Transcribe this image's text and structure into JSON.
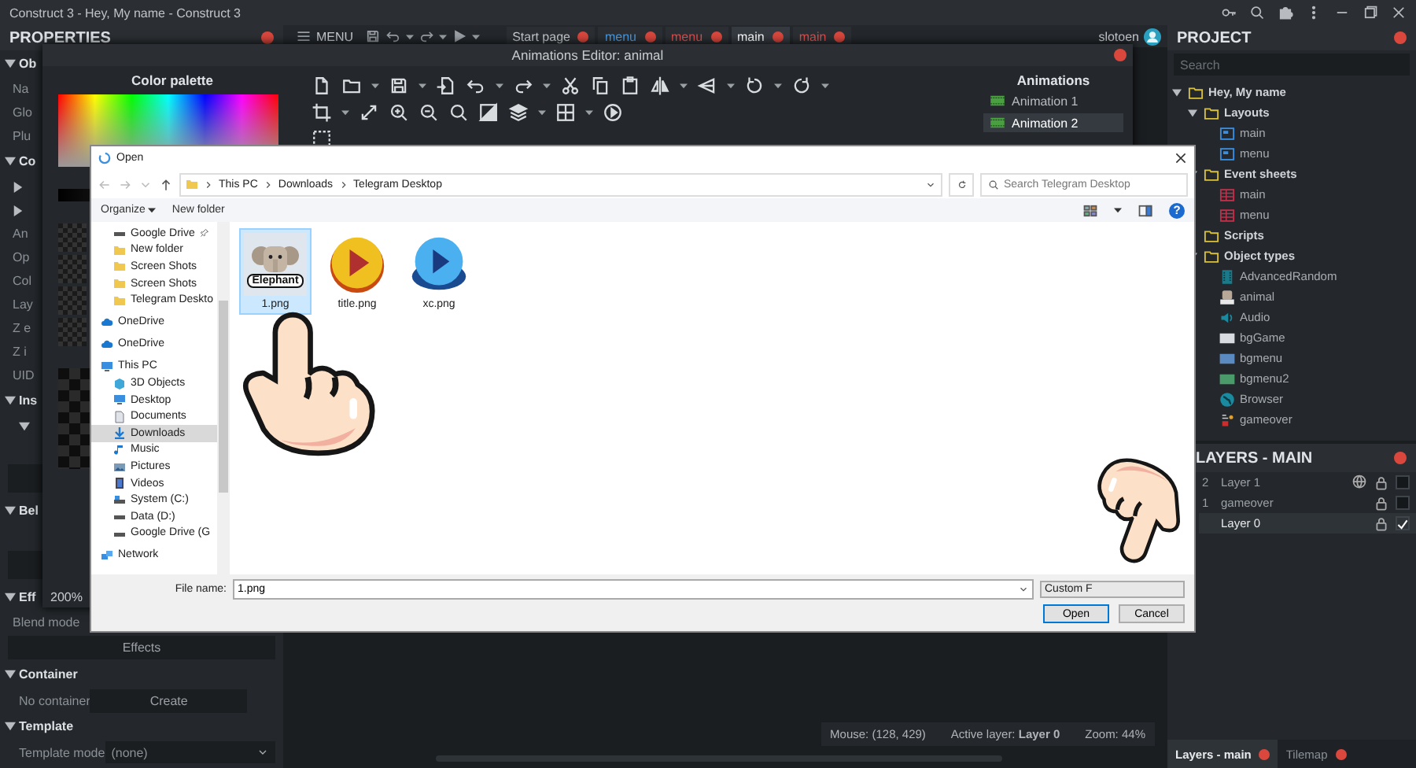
{
  "app_title": "Construct 3 - Hey, My name - Construct 3",
  "properties": {
    "title": "PROPERTIES",
    "rows": [
      {
        "kind": "section",
        "label": "Ob"
      },
      {
        "kind": "field",
        "label": "Na"
      },
      {
        "kind": "field",
        "label": "Glo"
      },
      {
        "kind": "field",
        "label": "Plu"
      },
      {
        "kind": "section",
        "label": "Co"
      },
      {
        "kind": "arrow"
      },
      {
        "kind": "arrow"
      },
      {
        "kind": "field",
        "label": "An"
      },
      {
        "kind": "field",
        "label": "Op"
      },
      {
        "kind": "field",
        "label": "Col"
      },
      {
        "kind": "field",
        "label": "Lay"
      },
      {
        "kind": "field",
        "label": "Z e"
      },
      {
        "kind": "field",
        "label": "Z i"
      },
      {
        "kind": "field",
        "label": "UID"
      },
      {
        "kind": "section",
        "label": "Ins"
      },
      {
        "kind": "expander"
      },
      {
        "kind": "bar"
      },
      {
        "kind": "section",
        "label": "Bel"
      },
      {
        "kind": "bar"
      },
      {
        "kind": "section",
        "label": "Eff"
      },
      {
        "kind": "field",
        "label": "Blend mode"
      },
      {
        "kind": "button",
        "label": "Effects"
      },
      {
        "kind": "section",
        "label": "Container"
      },
      {
        "kind": "pair",
        "label": "No container",
        "button": "Create"
      },
      {
        "kind": "section",
        "label": "Template"
      },
      {
        "kind": "select",
        "label": "Template mode",
        "value": "(none)"
      }
    ]
  },
  "menu_bar": {
    "menu_label": "MENU",
    "user": "slotoen",
    "tabs": [
      {
        "label": "Start page",
        "kind": "page",
        "selected": false
      },
      {
        "label": "menu",
        "kind": "layout",
        "selected": false
      },
      {
        "label": "menu",
        "kind": "eventsheet",
        "selected": false
      },
      {
        "label": "main",
        "kind": "layout",
        "selected": true
      },
      {
        "label": "main",
        "kind": "eventsheet",
        "selected": false
      }
    ]
  },
  "animations_editor": {
    "title": "Animations Editor: animal",
    "palette_title": "Color palette",
    "zoom": "200%",
    "animations_title": "Animations",
    "animations": [
      {
        "name": "Animation 1",
        "selected": false
      },
      {
        "name": "Animation 2",
        "selected": true
      }
    ]
  },
  "project": {
    "title": "PROJECT",
    "search_placeholder": "Search",
    "tree": [
      {
        "name": "Hey, My name",
        "kind": "folder",
        "expanded": true,
        "children": [
          {
            "name": "Layouts",
            "kind": "folder",
            "expanded": true,
            "children": [
              {
                "name": "main",
                "kind": "layout"
              },
              {
                "name": "menu",
                "kind": "layout"
              }
            ]
          },
          {
            "name": "Event sheets",
            "kind": "folder",
            "expanded": true,
            "children": [
              {
                "name": "main",
                "kind": "eventsheet"
              },
              {
                "name": "menu",
                "kind": "eventsheet"
              }
            ]
          },
          {
            "name": "Scripts",
            "kind": "folder"
          },
          {
            "name": "Object types",
            "kind": "folder",
            "expanded": true,
            "children": [
              {
                "name": "AdvancedRandom",
                "kind": "random"
              },
              {
                "name": "animal",
                "kind": "sprite"
              },
              {
                "name": "Audio",
                "kind": "audio"
              },
              {
                "name": "bgGame",
                "kind": "background",
                "color": "#d8dce0"
              },
              {
                "name": "bgmenu",
                "kind": "background",
                "color": "#5a8ac0"
              },
              {
                "name": "bgmenu2",
                "kind": "background",
                "color": "#4a9a6a"
              },
              {
                "name": "Browser",
                "kind": "browser"
              },
              {
                "name": "gameover",
                "kind": "text"
              }
            ]
          }
        ]
      }
    ]
  },
  "layers": {
    "title": "LAYERS - MAIN",
    "rows": [
      {
        "number": "2",
        "name": "Layer 1",
        "global": true,
        "selected": false,
        "visible": false
      },
      {
        "number": "1",
        "name": "gameover",
        "global": false,
        "selected": false,
        "visible": false
      },
      {
        "name": "Layer 0",
        "global": false,
        "selected": true,
        "visible": true
      }
    ],
    "tabs": [
      {
        "label": "Layers - main",
        "selected": true
      },
      {
        "label": "Tilemap",
        "selected": false
      }
    ]
  },
  "status_bar": {
    "mouse": "Mouse: (128, 429)",
    "active_layer": "Active layer: **Layer 0**",
    "zoom": "Zoom: 44%"
  },
  "open_dialog": {
    "title": "Open",
    "breadcrumb": [
      "This PC",
      "Downloads",
      "Telegram Desktop"
    ],
    "search_placeholder": "Search Telegram Desktop",
    "organize": "Organize",
    "new_folder": "New folder",
    "help": "?",
    "quick_access": [
      {
        "name": "Google Drive",
        "kind": "drive",
        "pinned": true,
        "selected": false
      },
      {
        "name": "New folder",
        "kind": "folder",
        "pinned": false,
        "selected": false
      },
      {
        "name": "Screen Shots",
        "kind": "folder",
        "pinned": false,
        "selected": false
      },
      {
        "name": "Screen Shots",
        "kind": "folder",
        "pinned": false,
        "selected": false
      },
      {
        "name": "Telegram Deskto",
        "kind": "folder",
        "pinned": false,
        "selected": false
      }
    ],
    "locations": [
      {
        "name": "OneDrive",
        "kind": "cloud",
        "selected": false
      },
      {
        "name": "OneDrive",
        "kind": "cloud",
        "selected": false
      },
      {
        "name": "This PC",
        "kind": "computer",
        "selected": false,
        "children": [
          {
            "name": "3D Objects",
            "kind": "cube",
            "selected": false
          },
          {
            "name": "Desktop",
            "kind": "desktop",
            "selected": false
          },
          {
            "name": "Documents",
            "kind": "document",
            "selected": false
          },
          {
            "name": "Downloads",
            "kind": "download",
            "selected": true
          },
          {
            "name": "Music",
            "kind": "music",
            "selected": false
          },
          {
            "name": "Pictures",
            "kind": "pictures",
            "selected": false
          },
          {
            "name": "Videos",
            "kind": "videos",
            "selected": false
          },
          {
            "name": "System (C:)",
            "kind": "system",
            "selected": false
          },
          {
            "name": "Data (D:)",
            "kind": "drive",
            "selected": false
          },
          {
            "name": "Google Drive (G",
            "kind": "drive",
            "selected": false
          }
        ]
      },
      {
        "name": "Network",
        "kind": "network",
        "selected": false
      }
    ],
    "files": [
      {
        "name": "1.png",
        "kind": "elephant",
        "thumbnail_text": "Elephant",
        "selected": true
      },
      {
        "name": "title.png",
        "kind": "play-yellow",
        "selected": false
      },
      {
        "name": "xc.png",
        "kind": "play-blue",
        "selected": false
      }
    ],
    "file_name_label": "File name:",
    "file_name": "1.png",
    "filter": "Custom F",
    "buttons": [
      {
        "label": "Open",
        "kind": "primary"
      },
      {
        "label": "Cancel",
        "kind": "secondary"
      }
    ]
  }
}
